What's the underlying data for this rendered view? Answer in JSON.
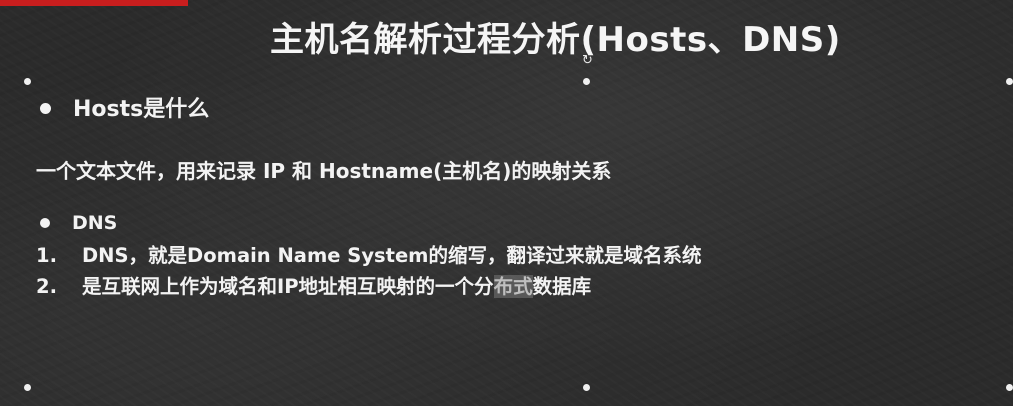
{
  "slide": {
    "title": "主机名解析过程分析(Hosts、DNS)",
    "hosts_heading": "Hosts是什么",
    "hosts_description": "一个文本文件，用来记录 IP 和 Hostname(主机名)的映射关系",
    "dns_heading": "DNS",
    "dns_items": [
      {
        "number": "1.",
        "text": "DNS，就是Domain Name System的缩写，翻译过来就是域名系统"
      },
      {
        "number": "2.",
        "text_before": "是互联网上作为域名和IP地址相互映射的一个分",
        "text_highlight": "布式",
        "text_after": "数据库"
      }
    ]
  },
  "colors": {
    "background": "#2b2b2b",
    "accent": "#c81e1e",
    "text": "#f2f2f2"
  }
}
